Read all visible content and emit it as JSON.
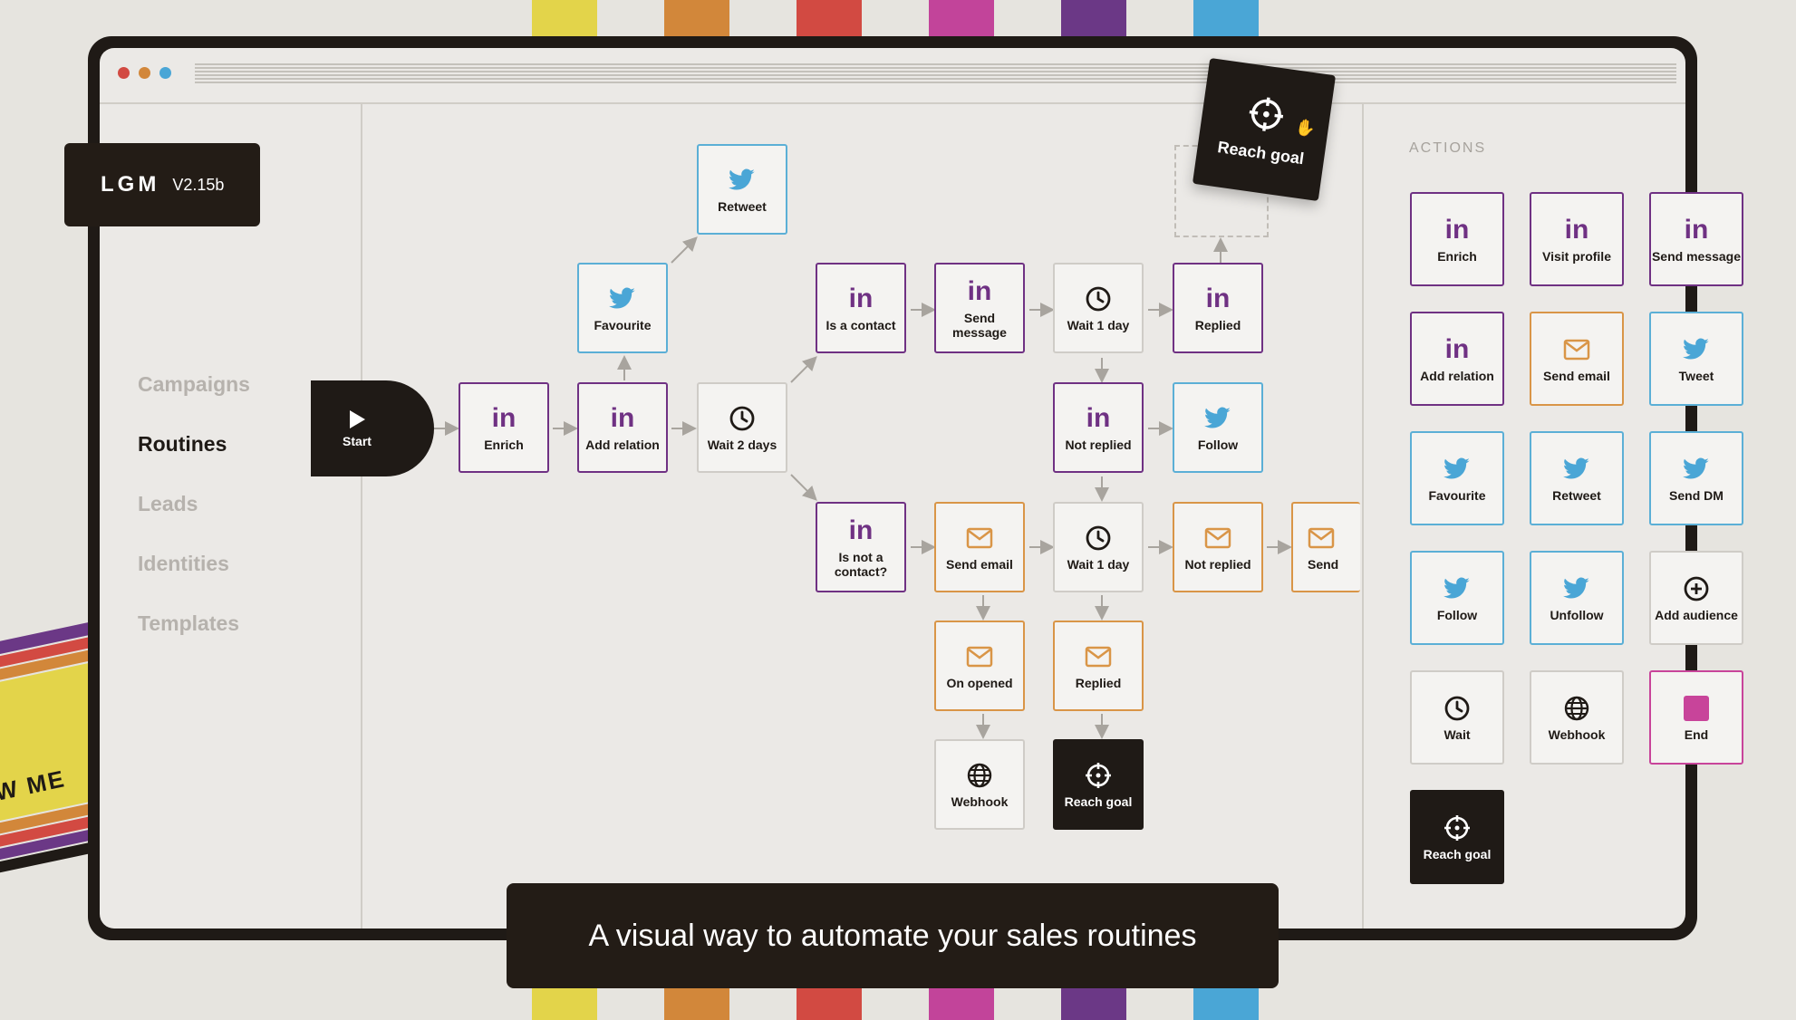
{
  "app": {
    "name": "LGM",
    "version": "V2.15b"
  },
  "sidebar": {
    "items": [
      {
        "label": "Campaigns"
      },
      {
        "label": "Routines"
      },
      {
        "label": "Leads"
      },
      {
        "label": "Identities"
      },
      {
        "label": "Templates"
      }
    ],
    "active": "Routines"
  },
  "canvas": {
    "start_label": "Start",
    "nodes": [
      {
        "label": "Retweet",
        "icon": "twitter-icon"
      },
      {
        "label": "Favourite",
        "icon": "twitter-icon"
      },
      {
        "label": "Enrich",
        "icon": "linkedin-icon"
      },
      {
        "label": "Add relation",
        "icon": "linkedin-icon"
      },
      {
        "label": "Wait 2 days",
        "icon": "clock-icon"
      },
      {
        "label": "Is a contact",
        "icon": "linkedin-icon"
      },
      {
        "label": "Send message",
        "icon": "linkedin-icon"
      },
      {
        "label": "Wait 1 day",
        "icon": "clock-icon"
      },
      {
        "label": "Replied",
        "icon": "linkedin-icon"
      },
      {
        "label": "Not replied",
        "icon": "linkedin-icon"
      },
      {
        "label": "Follow",
        "icon": "twitter-icon"
      },
      {
        "label": "Is not a contact?",
        "icon": "linkedin-icon"
      },
      {
        "label": "Send email",
        "icon": "mail-icon"
      },
      {
        "label": "Wait 1 day",
        "icon": "clock-icon"
      },
      {
        "label": "Not replied",
        "icon": "mail-icon"
      },
      {
        "label": "Send",
        "icon": "mail-icon"
      },
      {
        "label": "On opened",
        "icon": "mail-icon"
      },
      {
        "label": "Replied",
        "icon": "mail-icon"
      },
      {
        "label": "Webhook",
        "icon": "globe-icon"
      },
      {
        "label": "Reach goal",
        "icon": "target-icon"
      }
    ],
    "dragging": {
      "label": "Reach goal",
      "icon": "target-icon"
    }
  },
  "actions": {
    "title": "ACTIONS",
    "items": [
      {
        "label": "Enrich",
        "icon": "linkedin-icon"
      },
      {
        "label": "Visit profile",
        "icon": "linkedin-icon"
      },
      {
        "label": "Send message",
        "icon": "linkedin-icon"
      },
      {
        "label": "Add relation",
        "icon": "linkedin-icon"
      },
      {
        "label": "Send email",
        "icon": "mail-icon"
      },
      {
        "label": "Tweet",
        "icon": "twitter-icon"
      },
      {
        "label": "Favourite",
        "icon": "twitter-icon"
      },
      {
        "label": "Retweet",
        "icon": "twitter-icon"
      },
      {
        "label": "Send DM",
        "icon": "twitter-icon"
      },
      {
        "label": "Follow",
        "icon": "twitter-icon"
      },
      {
        "label": "Unfollow",
        "icon": "twitter-icon"
      },
      {
        "label": "Add audience",
        "icon": "plus-circle-icon"
      },
      {
        "label": "Wait",
        "icon": "clock-icon"
      },
      {
        "label": "Webhook",
        "icon": "globe-icon"
      },
      {
        "label": "End",
        "icon": "stop-square-icon"
      },
      {
        "label": "Reach goal",
        "icon": "target-icon"
      }
    ]
  },
  "banner": {
    "text": "A visual way to automate your sales routines"
  },
  "poster": {
    "text": "W ME"
  },
  "colors": {
    "linkedin": "#6f3183",
    "twitter": "#5bafd6",
    "email": "#d99547",
    "dark": "#1f1a16",
    "end": "#c8449a"
  }
}
